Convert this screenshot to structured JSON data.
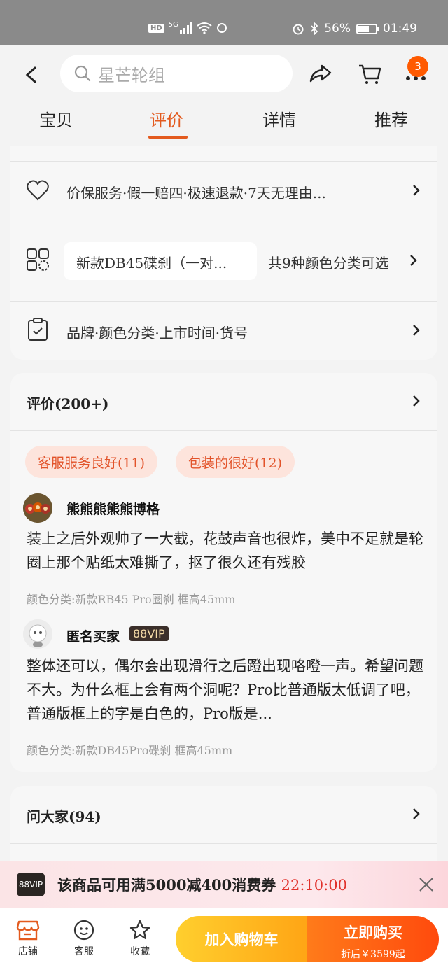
{
  "status_bar": {
    "network": "5G",
    "hd": "HD",
    "battery": "56%",
    "time": "01:49"
  },
  "header": {
    "search_placeholder": "星芒轮组",
    "cart_badge": "3",
    "tabs": [
      {
        "label": "宝贝",
        "active": false
      },
      {
        "label": "评价",
        "active": true
      },
      {
        "label": "详情",
        "active": false
      },
      {
        "label": "推荐",
        "active": false
      }
    ]
  },
  "service": {
    "guarantee": "价保服务·假一赔四·极速退款·7天无理由...",
    "sku_selected": "新款DB45碟刹（一对...",
    "sku_count": "共9种颜色分类可选",
    "params": "品牌·颜色分类·上市时间·货号"
  },
  "reviews": {
    "title": "评价(200+)",
    "tags": [
      "客服服务良好(11)",
      "包装的很好(12)"
    ],
    "items": [
      {
        "user": "熊熊熊熊熊博格",
        "vip": "",
        "text": "装上之后外观帅了一大截，花鼓声音也很炸，美中不足就是轮圈上那个贴纸太难撕了，抠了很久还有残胶",
        "sku": "颜色分类:新款RB45 Pro圈刹 框高45mm"
      },
      {
        "user": "匿名买家",
        "vip": "88VIP",
        "text": "整体还可以，偶尔会出现滑行之后蹬出现咯噔一声。希望问题不大。为什么框上会有两个洞呢？Pro比普通版太低调了吧，普通版框上的字是白色的，Pro版是...",
        "sku": "颜色分类:新款DB45Pro碟刹 框高45mm"
      }
    ]
  },
  "qa": {
    "title": "问大家(94)"
  },
  "coupon": {
    "logo": "88VIP",
    "text": "该商品可用满5000减400消费券",
    "countdown": "22:10:00"
  },
  "bottom_bar": {
    "shop": "店铺",
    "service": "客服",
    "favorite": "收藏",
    "add_cart": "加入购物车",
    "buy_now": "立即购买",
    "price_note": "折后￥3599起"
  },
  "colors": {
    "accent": "#e35a1e",
    "tag_bg": "#fde4dc",
    "buy": "#ff5a0d",
    "cart": "#ffb51f"
  }
}
